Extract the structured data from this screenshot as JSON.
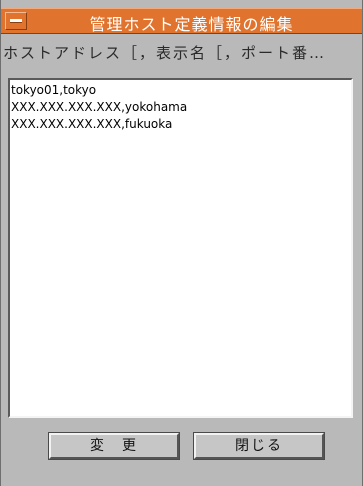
{
  "window": {
    "title": "管理ホスト定義情報の編集",
    "menu_icon": "window-menu-icon",
    "accent_color": "#e0742e"
  },
  "header": {
    "label": "ホストアドレス［，表示名［，ポート番…"
  },
  "editor": {
    "lines": [
      "tokyo01,tokyo",
      "XXX.XXX.XXX.XXX,yokohama",
      "XXX.XXX.XXX.XXX,fukuoka"
    ]
  },
  "buttons": {
    "change_label": "変更",
    "close_label": "閉じる"
  }
}
